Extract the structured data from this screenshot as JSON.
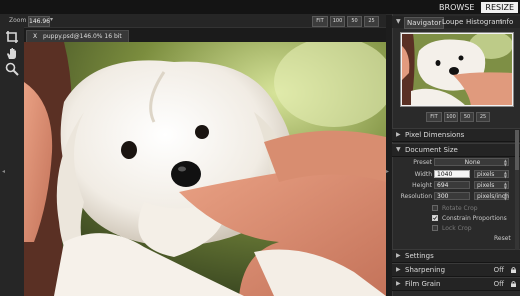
{
  "topnav": {
    "items": [
      {
        "label": "BROWSE",
        "active": false
      },
      {
        "label": "RESIZE",
        "active": true
      }
    ]
  },
  "toolbar": {
    "zoom_label": "Zoom",
    "zoom_value": "146.96",
    "zoom_buttons": [
      "FIT",
      "100",
      "50",
      "25"
    ]
  },
  "tools": [
    "crop-icon",
    "hand-icon",
    "magnifier-icon"
  ],
  "tab": {
    "close_glyph": "X",
    "title": "puppy.psd@146.0% 16 bit"
  },
  "navigator": {
    "tabs": [
      {
        "label": "Navigator",
        "active": true
      },
      {
        "label": "Loupe",
        "active": false
      },
      {
        "label": "Histogram",
        "active": false
      },
      {
        "label": "Info",
        "active": false
      }
    ],
    "zoom_buttons": [
      "FIT",
      "100",
      "50",
      "25"
    ]
  },
  "pixel_dimensions": {
    "label": "Pixel Dimensions",
    "collapsed": true
  },
  "document_size": {
    "label": "Document Size",
    "preset": {
      "label": "Preset",
      "value": "None"
    },
    "width": {
      "label": "Width",
      "value": "1040",
      "unit": "pixels"
    },
    "height": {
      "label": "Height",
      "value": "694",
      "unit": "pixels"
    },
    "resolution": {
      "label": "Resolution",
      "value": "300",
      "unit": "pixels/inch"
    },
    "checkboxes": [
      {
        "label": "Rotate Crop",
        "checked": false,
        "enabled": false
      },
      {
        "label": "Constrain Proportions",
        "checked": true,
        "enabled": true
      },
      {
        "label": "Lock Crop",
        "checked": false,
        "enabled": false
      }
    ],
    "reset_label": "Reset"
  },
  "sections": [
    {
      "label": "Settings",
      "status": ""
    },
    {
      "label": "Sharpening",
      "status": "Off"
    },
    {
      "label": "Film Grain",
      "status": "Off"
    }
  ],
  "colors": {
    "background": "#1d1d1d",
    "panel": "#2a2a2a",
    "active_nav": "#f0f0f0"
  }
}
